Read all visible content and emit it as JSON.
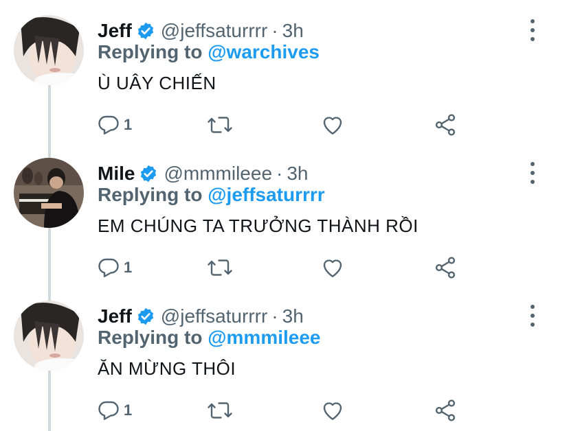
{
  "tweets": [
    {
      "name": "Jeff",
      "handle": "@jeffsaturrrr",
      "separator": "·",
      "time": "3h",
      "replying_prefix": "Replying to",
      "replying_to": "@warchives",
      "text": "Ù UÂY CHIẾN",
      "reply_count": "1",
      "avatar": "jeff-avatar"
    },
    {
      "name": "Mile",
      "handle": "@mmmileee",
      "separator": "·",
      "time": "3h",
      "replying_prefix": "Replying to",
      "replying_to": "@jeffsaturrrr",
      "text": "EM CHÚNG TA TRƯỞNG THÀNH RỒI",
      "reply_count": "1",
      "avatar": "mile-avatar"
    },
    {
      "name": "Jeff",
      "handle": "@jeffsaturrrr",
      "separator": "·",
      "time": "3h",
      "replying_prefix": "Replying to",
      "replying_to": "@mmmileee",
      "text": "ĂN MỪNG THÔI",
      "reply_count": "1",
      "avatar": "jeff-avatar"
    }
  ],
  "icons": {
    "reply": "reply-icon",
    "retweet": "retweet-icon",
    "like": "heart-icon",
    "share": "share-icon",
    "more": "more-icon",
    "verified": "verified-badge-icon"
  },
  "colors": {
    "accent": "#1d9bf0",
    "secondary_text": "#536471",
    "primary_text": "#0f1419",
    "thread_line": "#cfd9de"
  }
}
